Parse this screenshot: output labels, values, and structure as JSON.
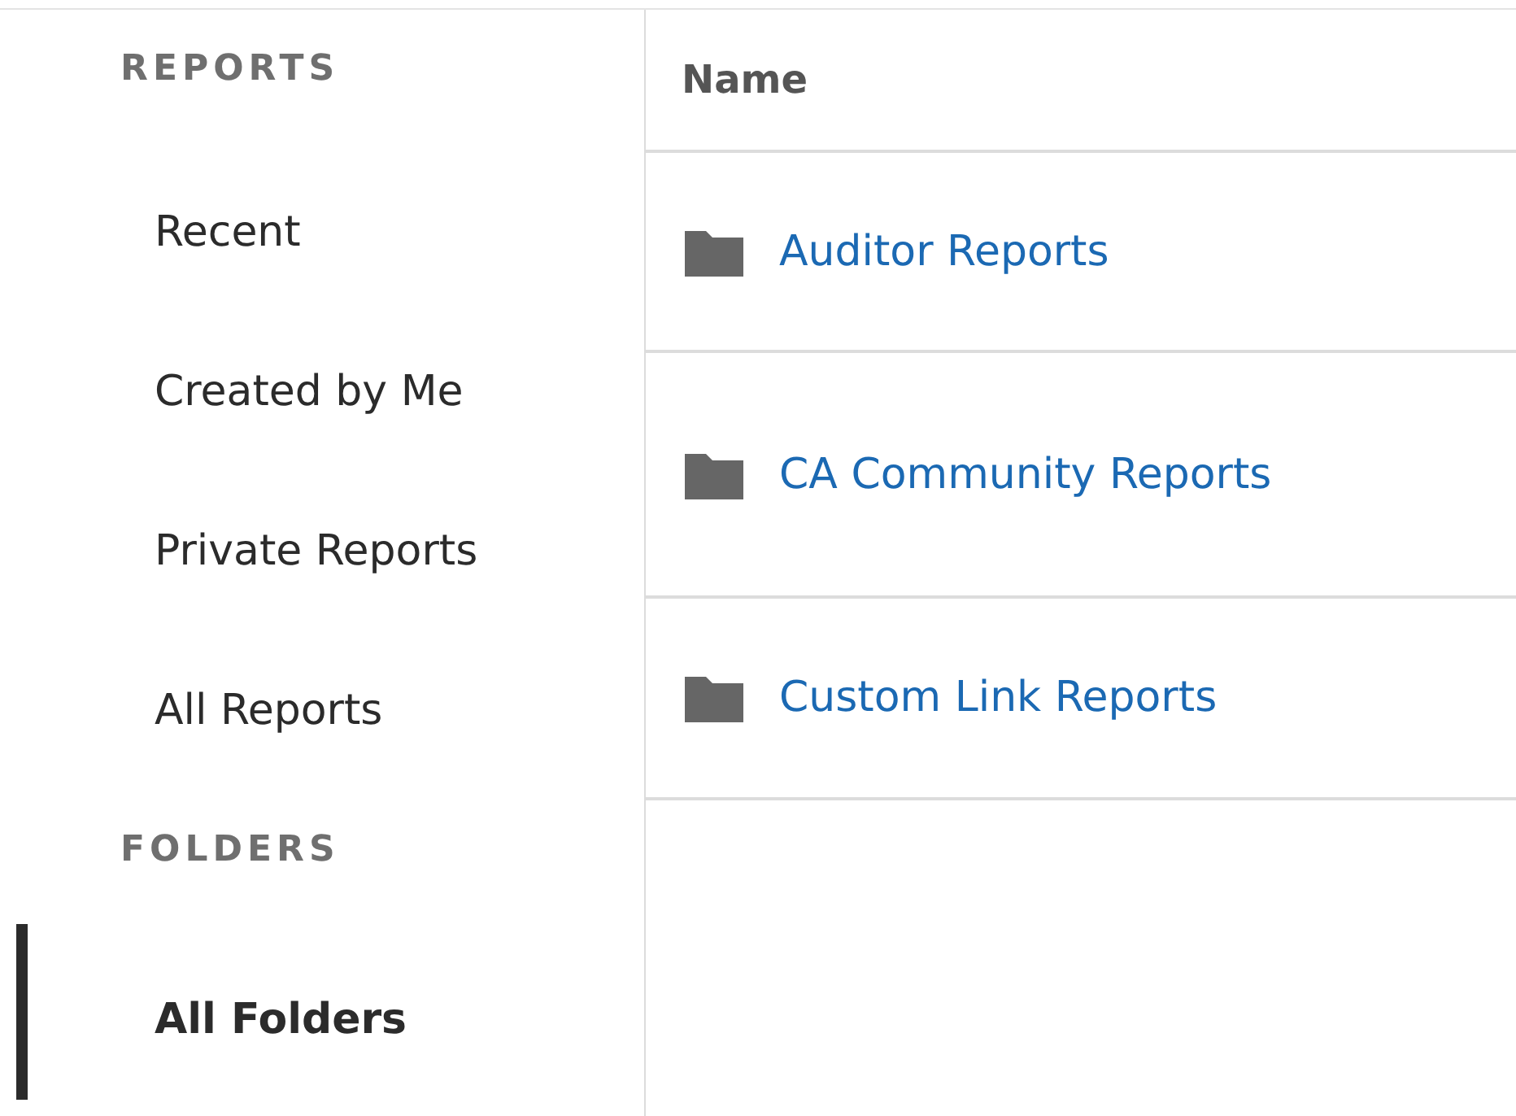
{
  "sidebar": {
    "sections": [
      {
        "title": "REPORTS",
        "items": [
          {
            "label": "Recent",
            "selected": false
          },
          {
            "label": "Created by Me",
            "selected": false
          },
          {
            "label": "Private Reports",
            "selected": false
          },
          {
            "label": "All Reports",
            "selected": false
          }
        ]
      },
      {
        "title": "FOLDERS",
        "items": [
          {
            "label": "All Folders",
            "selected": true
          }
        ]
      }
    ]
  },
  "table": {
    "columns": [
      "Name"
    ],
    "rows": [
      {
        "name": "Auditor Reports"
      },
      {
        "name": "CA Community Reports"
      },
      {
        "name": "Custom Link Reports"
      }
    ]
  }
}
